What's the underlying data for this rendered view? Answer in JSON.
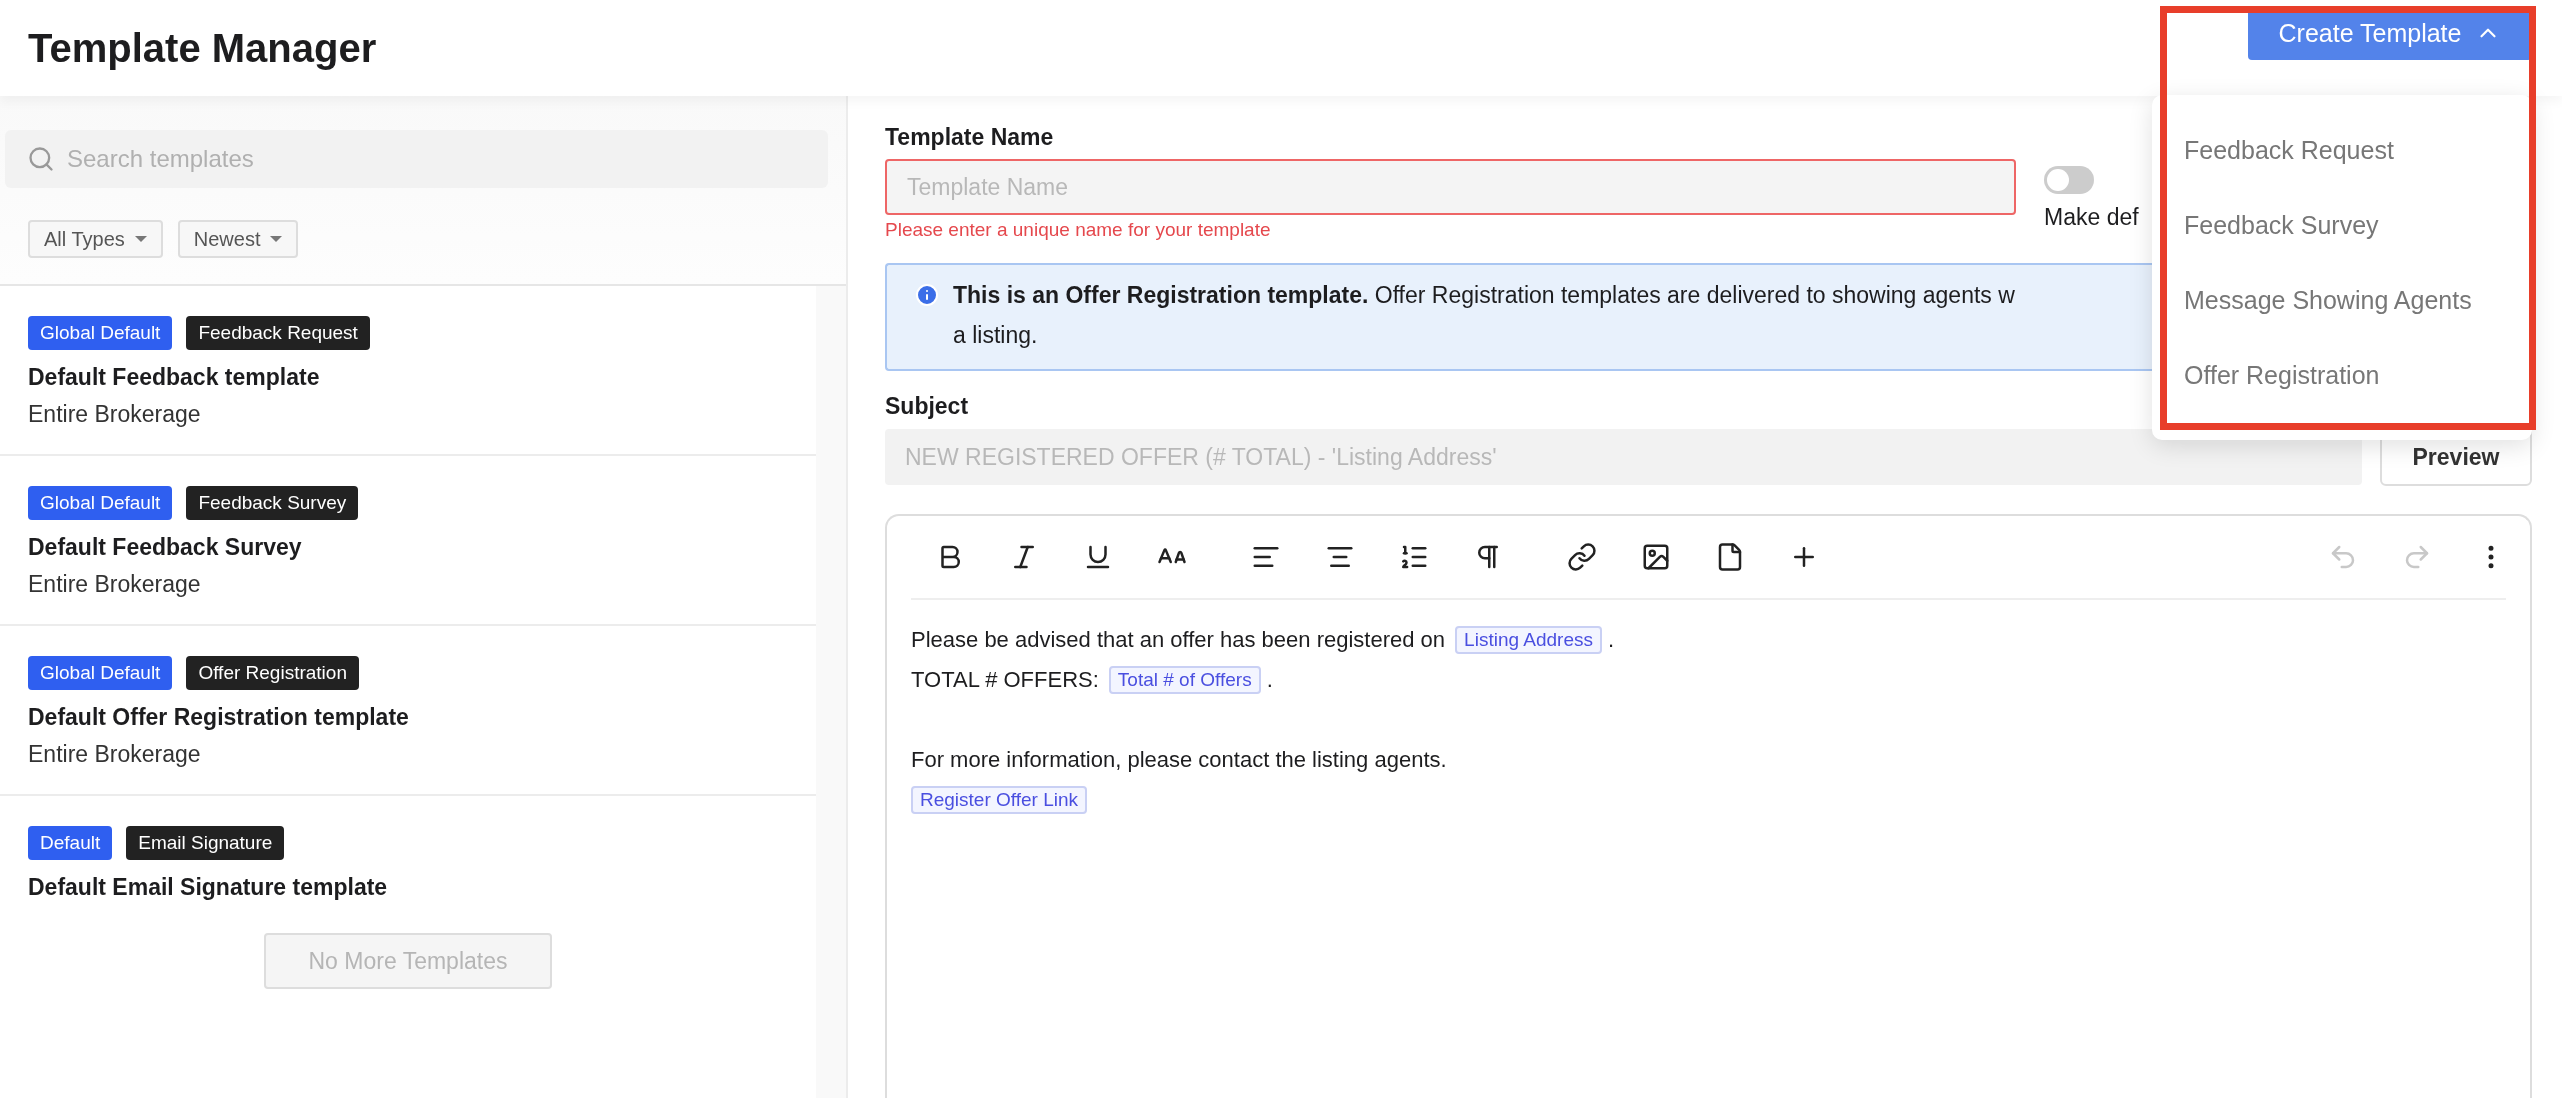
{
  "header": {
    "title": "Template Manager",
    "create_button": {
      "label": "Create Template",
      "expanded": true
    }
  },
  "create_menu": {
    "items": [
      {
        "label": "Feedback Request"
      },
      {
        "label": "Feedback Survey"
      },
      {
        "label": "Message Showing Agents"
      },
      {
        "label": "Offer Registration"
      }
    ]
  },
  "sidebar": {
    "search": {
      "placeholder": "Search templates"
    },
    "filters": [
      {
        "label": "All Types"
      },
      {
        "label": "Newest"
      }
    ],
    "templates": [
      {
        "scope": "Global Default",
        "type": "Feedback Request",
        "name": "Default Feedback template",
        "audience": "Entire Brokerage"
      },
      {
        "scope": "Global Default",
        "type": "Feedback Survey",
        "name": "Default Feedback Survey",
        "audience": "Entire Brokerage"
      },
      {
        "scope": "Global Default",
        "type": "Offer Registration",
        "name": "Default Offer Registration template",
        "audience": "Entire Brokerage"
      },
      {
        "scope": "Default",
        "type": "Email Signature",
        "name": "Default Email Signature template"
      }
    ],
    "more_button": {
      "label": "No More Templates",
      "disabled": true
    }
  },
  "form": {
    "name_label": "Template Name",
    "name_field": {
      "placeholder": "Template Name",
      "error": true
    },
    "name_error": "Please enter a unique name for your template",
    "default_toggle": {
      "on": false,
      "label": "Make def"
    },
    "banner": {
      "lines": [
        "**This is an Offer Registration template.** Offer Registration templates are delivered to showing agents w",
        "a listing."
      ]
    },
    "subject_label": "Subject",
    "subject_field": {
      "value": "NEW REGISTERED OFFER (# TOTAL) - 'Listing Address'",
      "disabled": true
    },
    "preview_button": "Preview",
    "editor": {
      "undo": {
        "disabled": true
      },
      "redo": {
        "disabled": true
      },
      "lines": [
        {
          "kind": "line",
          "parts": [
            {
              "kind": "text",
              "text": "Please be advised that an offer has been registered on"
            },
            {
              "kind": "tag",
              "text": "Listing Address"
            },
            {
              "kind": "text",
              "text": "."
            }
          ]
        },
        {
          "kind": "line",
          "parts": [
            {
              "kind": "text",
              "text": "TOTAL # OFFERS:"
            },
            {
              "kind": "tag",
              "text": "Total # of Offers"
            },
            {
              "kind": "text",
              "text": "."
            }
          ]
        },
        {
          "kind": "spacer"
        },
        {
          "kind": "line",
          "parts": [
            {
              "kind": "text",
              "text": "For more information, please contact the listing agents."
            }
          ]
        },
        {
          "kind": "line",
          "parts": [
            {
              "kind": "tag",
              "text": "Register Offer Link"
            }
          ]
        }
      ]
    }
  }
}
